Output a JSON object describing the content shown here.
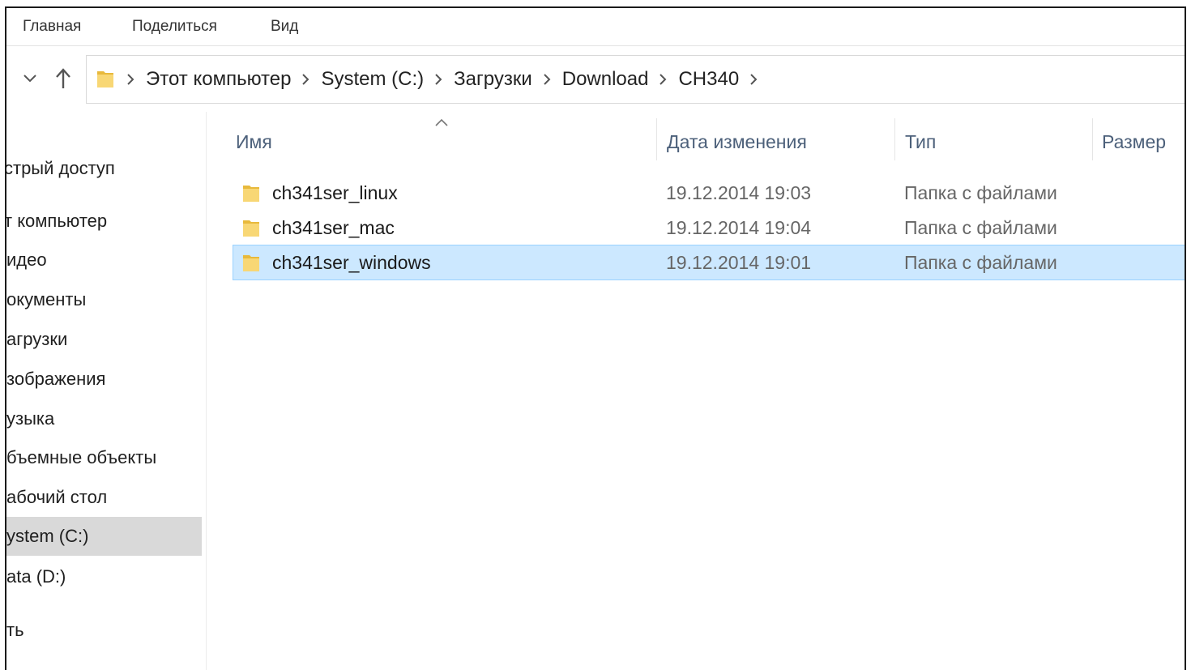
{
  "ribbon": {
    "tabs": [
      "Главная",
      "Поделиться",
      "Вид"
    ]
  },
  "nav": {
    "down_icon": "chevron-down-icon",
    "up_icon": "arrow-up-icon"
  },
  "breadcrumb": {
    "icon": "folder-icon",
    "items": [
      "Этот компьютер",
      "System (C:)",
      "Загрузки",
      "Download",
      "CH340"
    ]
  },
  "sidebar": {
    "items": [
      {
        "label": "стрый доступ"
      },
      {
        "label": "т компьютер"
      },
      {
        "label": "идео"
      },
      {
        "label": "окументы"
      },
      {
        "label": "агрузки"
      },
      {
        "label": "зображения"
      },
      {
        "label": "узыка"
      },
      {
        "label": "бъемные объекты"
      },
      {
        "label": "абочий стол"
      },
      {
        "label": "ystem (C:)",
        "selected": true
      },
      {
        "label": "ata (D:)"
      },
      {
        "label": "ть"
      }
    ]
  },
  "file_list": {
    "columns": {
      "name": "Имя",
      "date": "Дата изменения",
      "type": "Тип",
      "size": "Размер"
    },
    "sort_icon": "sort-ascending-icon",
    "rows": [
      {
        "name": "ch341ser_linux",
        "date": "19.12.2014 19:03",
        "type": "Папка с файлами",
        "selected": false
      },
      {
        "name": "ch341ser_mac",
        "date": "19.12.2014 19:04",
        "type": "Папка с файлами",
        "selected": false
      },
      {
        "name": "ch341ser_windows",
        "date": "19.12.2014 19:01",
        "type": "Папка с файлами",
        "selected": true
      }
    ]
  },
  "colors": {
    "selection_bg": "#cce8ff",
    "selection_border": "#99d1ff",
    "sidebar_active": "#d9d9d9",
    "header_text": "#4c607a",
    "folder_yellow": "#f8d775"
  }
}
